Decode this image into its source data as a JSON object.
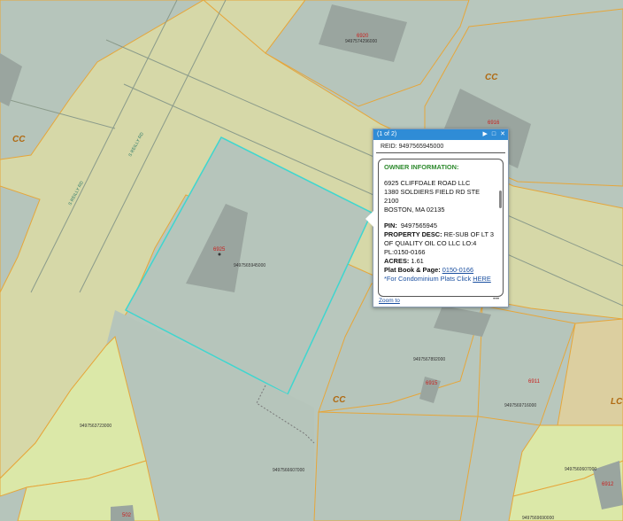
{
  "map": {
    "zone_labels": [
      "CC",
      "CC",
      "CC",
      "LC"
    ],
    "road_labels": [
      "S REILLY RD",
      "S REILLY RD"
    ],
    "addresses": [
      "6920",
      "6916",
      "6925",
      "6915",
      "6911",
      "6912",
      "502"
    ],
    "pins": [
      "9497574296000",
      "9497565945000",
      "9497567892000",
      "9497569716000",
      "9497563723000",
      "9497560607000",
      "9497566607000",
      "9497569690000"
    ]
  },
  "popup": {
    "title": "(1 of 2)",
    "reid": "REID: 9497565945000",
    "owner_heading": "OWNER INFORMATION:",
    "owner_lines": [
      "6925 CLIFFDALE ROAD LLC",
      "1380 SOLDIERS FIELD RD STE",
      "2100",
      "BOSTON, MA 02135"
    ],
    "pin_label": "PIN:",
    "pin_value": "9497565945",
    "desc_label": "PROPERTY DESC:",
    "desc_value": "RE-SUB OF LT 3 OF QUALITY OIL CO LLC LO:4 PL:0150-0166",
    "acres_label": "ACRES:",
    "acres_value": "1.61",
    "platbook_label": "Plat Book & Page:",
    "platbook_value": "0150-0166",
    "condo_text": "*For Condominium Plats Click",
    "condo_link": "HERE",
    "zoom_label": "Zoom to",
    "more_label": "•••"
  }
}
